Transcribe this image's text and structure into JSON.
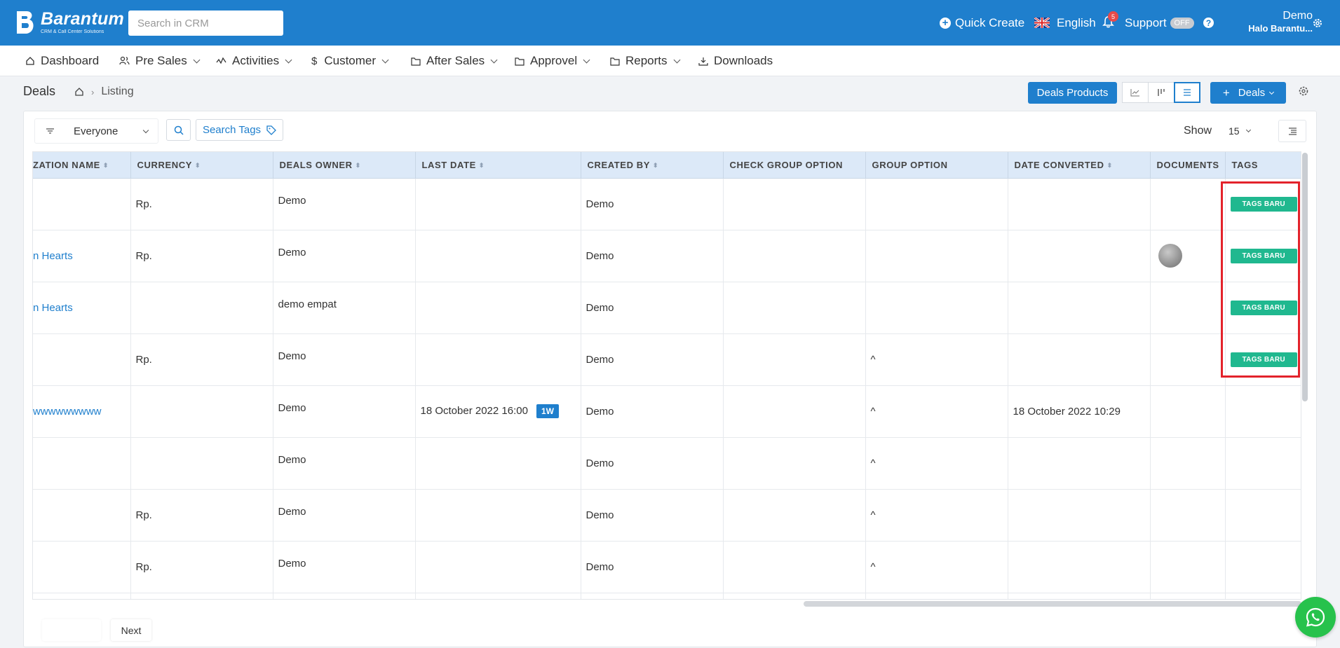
{
  "header": {
    "logo_name": "Barantum",
    "logo_sub": "CRM & Call Center Solutions",
    "search_placeholder": "Search in CRM",
    "quick_create": "Quick Create",
    "language": "English",
    "notifications_count": "5",
    "support": "Support",
    "support_toggle": "OFF",
    "user_name": "Demo",
    "user_company": "Halo Barantu..."
  },
  "nav": {
    "items": [
      {
        "label": "Dashboard"
      },
      {
        "label": "Pre Sales"
      },
      {
        "label": "Activities"
      },
      {
        "label": "Customer"
      },
      {
        "label": "After Sales"
      },
      {
        "label": "Approvel"
      },
      {
        "label": "Reports"
      },
      {
        "label": "Downloads"
      }
    ]
  },
  "page": {
    "title": "Deals",
    "breadcrumb_current": "Listing",
    "deals_products": "Deals Products",
    "add_deals": "Deals"
  },
  "filters": {
    "owner_filter": "Everyone",
    "search_tags": "Search Tags",
    "show_label": "Show",
    "show_value": "15"
  },
  "table": {
    "columns": [
      "ZATION NAME",
      "CURRENCY",
      "DEALS OWNER",
      "LAST DATE",
      "CREATED BY",
      "CHECK GROUP OPTION",
      "GROUP OPTION",
      "DATE CONVERTED",
      "DOCUMENTS",
      "TAGS"
    ],
    "rows": [
      {
        "org": "",
        "currency": "Rp.",
        "owner": "Demo",
        "last_date": "",
        "age": "",
        "created_by": "Demo",
        "check_group": "",
        "group": "",
        "converted": "",
        "doc": false,
        "tag": "TAGS BARU"
      },
      {
        "org": "n Hearts",
        "currency": "Rp.",
        "owner": "Demo",
        "last_date": "",
        "age": "",
        "created_by": "Demo",
        "check_group": "",
        "group": "",
        "converted": "",
        "doc": true,
        "tag": "TAGS BARU"
      },
      {
        "org": "n Hearts",
        "currency": "",
        "owner": "demo empat",
        "last_date": "",
        "age": "",
        "created_by": "Demo",
        "check_group": "",
        "group": "",
        "converted": "",
        "doc": false,
        "tag": "TAGS BARU"
      },
      {
        "org": "",
        "currency": "Rp.",
        "owner": "Demo",
        "last_date": "",
        "age": "",
        "created_by": "Demo",
        "check_group": "",
        "group": "^",
        "converted": "",
        "doc": false,
        "tag": "TAGS BARU"
      },
      {
        "org": "wwwwwwwww",
        "currency": "",
        "owner": "Demo",
        "last_date": "18 October 2022 16:00",
        "age": "1W",
        "created_by": "Demo",
        "check_group": "",
        "group": "^",
        "converted": "18 October 2022 10:29",
        "doc": false,
        "tag": ""
      },
      {
        "org": "",
        "currency": "",
        "owner": "Demo",
        "last_date": "",
        "age": "",
        "created_by": "Demo",
        "check_group": "",
        "group": "^",
        "converted": "",
        "doc": false,
        "tag": ""
      },
      {
        "org": "",
        "currency": "Rp.",
        "owner": "Demo",
        "last_date": "",
        "age": "",
        "created_by": "Demo",
        "check_group": "",
        "group": "^",
        "converted": "",
        "doc": false,
        "tag": ""
      },
      {
        "org": "",
        "currency": "Rp.",
        "owner": "Demo",
        "last_date": "",
        "age": "",
        "created_by": "Demo",
        "check_group": "",
        "group": "^",
        "converted": "",
        "doc": false,
        "tag": ""
      },
      {
        "org": "",
        "currency": "",
        "owner": "",
        "last_date": "",
        "age": "",
        "created_by": "",
        "check_group": "",
        "group": "",
        "converted": "",
        "doc": false,
        "tag": ""
      }
    ]
  },
  "pagination": {
    "next": "Next"
  },
  "colors": {
    "brand": "#1f7fcd",
    "tag_green": "#20b88f",
    "highlight_red": "#e3222b",
    "whatsapp": "#27c24c"
  },
  "icons": [
    "home-icon",
    "search-icon",
    "tag-icon",
    "gear-icon",
    "bell-icon",
    "help-icon",
    "whatsapp-icon",
    "line-chart-icon",
    "kanban-icon",
    "list-icon",
    "filter-lines-icon",
    "columns-icon"
  ]
}
